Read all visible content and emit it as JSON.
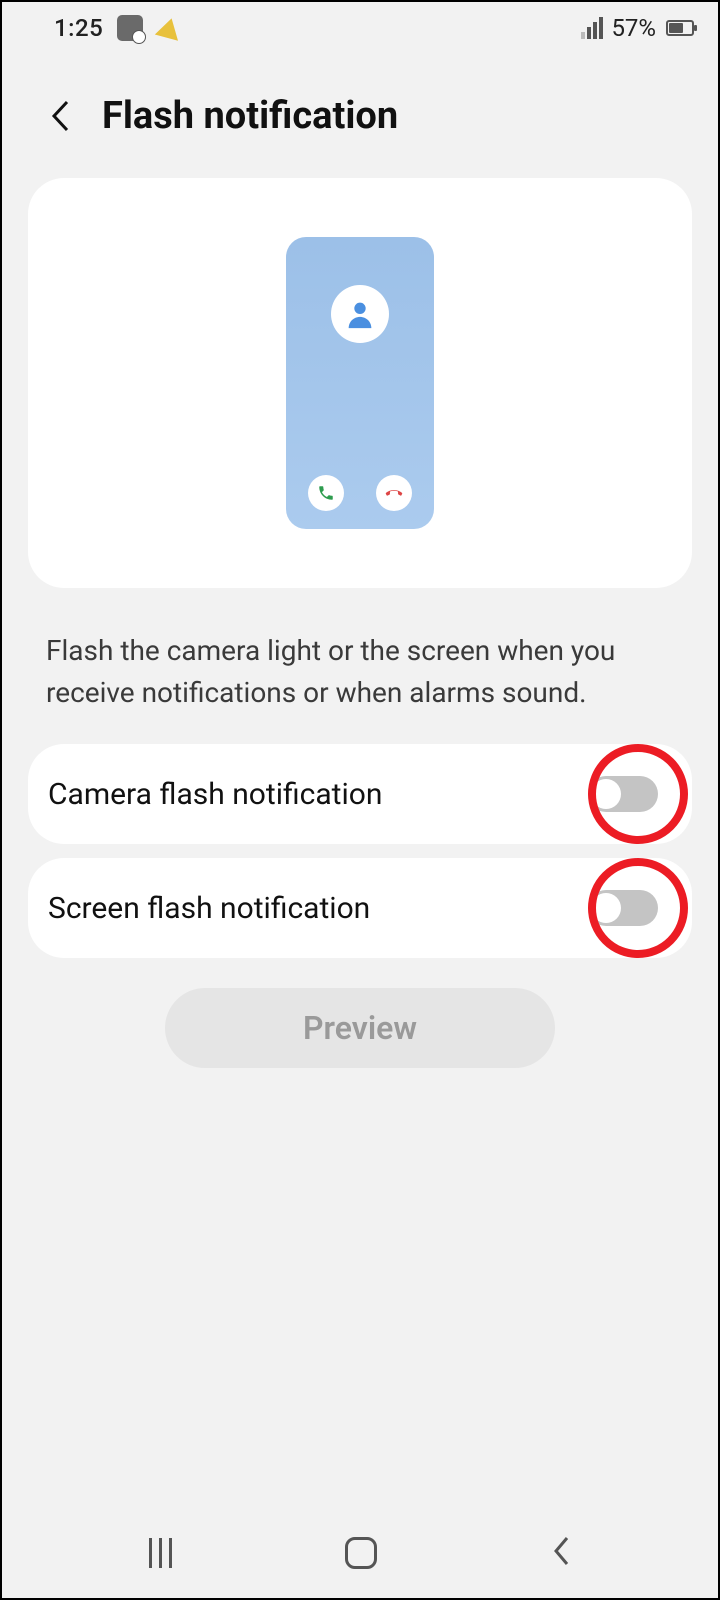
{
  "status": {
    "time": "1:25",
    "battery_pct": "57%"
  },
  "header": {
    "title": "Flash notification"
  },
  "description": "Flash the camera light or the screen when you receive notifications or when alarms sound.",
  "settings": {
    "camera_flash": {
      "label": "Camera flash notification",
      "enabled": false
    },
    "screen_flash": {
      "label": "Screen flash notification",
      "enabled": false
    }
  },
  "preview_button": "Preview"
}
